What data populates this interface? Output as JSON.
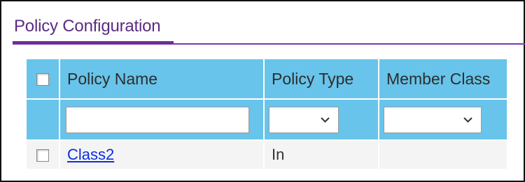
{
  "page": {
    "title": "Policy Configuration"
  },
  "table": {
    "headers": {
      "policy_name": "Policy Name",
      "policy_type": "Policy Type",
      "member_class": "Member Class"
    },
    "filters": {
      "policy_name_value": "",
      "policy_type_selected": "",
      "member_class_selected": ""
    },
    "rows": [
      {
        "policy_name": "Class2",
        "policy_type": "In",
        "member_class": ""
      }
    ]
  },
  "icons": {
    "checkbox": "checkbox",
    "dropdown": "chevron-down-icon"
  },
  "colors": {
    "header_bg": "#68c4ea",
    "title": "#5b2c82",
    "link": "#0b2ee0"
  }
}
